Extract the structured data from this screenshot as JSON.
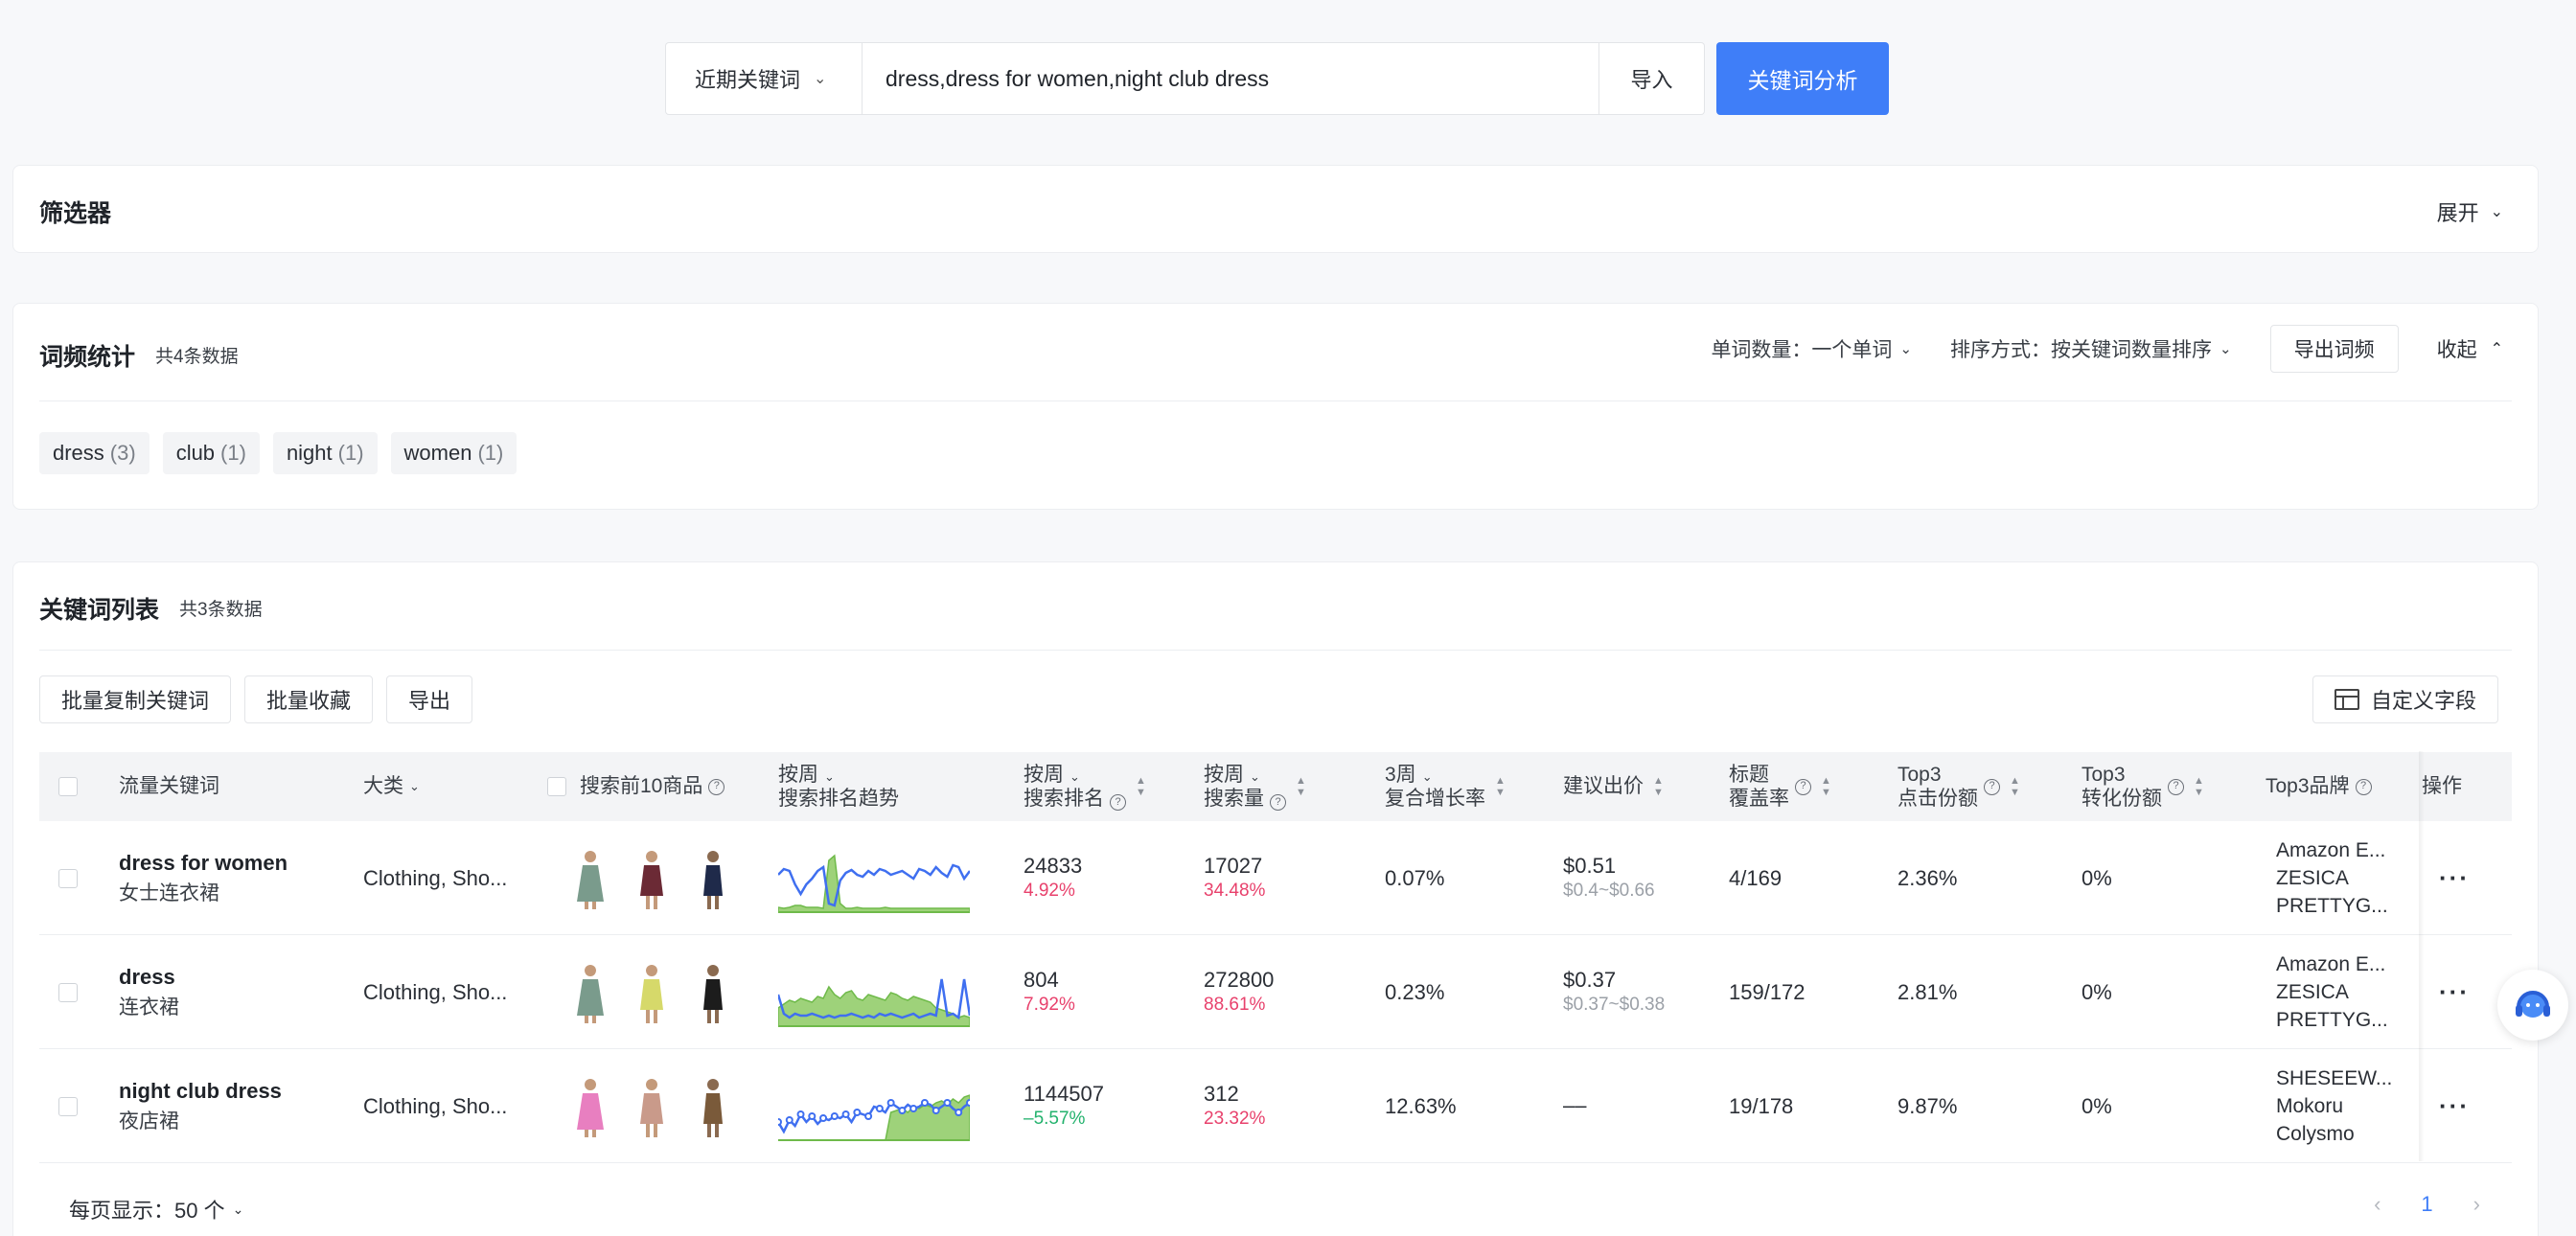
{
  "search": {
    "recent_label": "近期关键词",
    "input_value": "dress,dress for women,night club dress",
    "import_label": "导入",
    "analyze_label": "关键词分析"
  },
  "filter": {
    "title": "筛选器",
    "expand_label": "展开"
  },
  "word_freq": {
    "title": "词频统计",
    "count": "共4条数据",
    "word_count_label": "单词数量：一个单词",
    "sort_label": "排序方式：按关键词数量排序",
    "export_label": "导出词频",
    "collapse_label": "收起",
    "tags": [
      {
        "word": "dress",
        "n": "(3)"
      },
      {
        "word": "club",
        "n": "(1)"
      },
      {
        "word": "night",
        "n": "(1)"
      },
      {
        "word": "women",
        "n": "(1)"
      }
    ]
  },
  "keyword_list": {
    "title": "关键词列表",
    "count": "共3条数据",
    "batch_copy": "批量复制关键词",
    "batch_fav": "批量收藏",
    "export": "导出",
    "custom_fields": "自定义字段",
    "columns": {
      "keyword": "流量关键词",
      "category": "大类",
      "top10": "搜索前10商品",
      "trend_a": "按周",
      "trend_b": "搜索排名趋势",
      "rank_a": "按周",
      "rank_b": "搜索排名",
      "volume_a": "按周",
      "volume_b": "搜索量",
      "growth_a": "3周",
      "growth_b": "复合增长率",
      "bid": "建议出价",
      "title_a": "标题",
      "title_b": "覆盖率",
      "click_a": "Top3",
      "click_b": "点击份额",
      "conv_a": "Top3",
      "conv_b": "转化份额",
      "brand": "Top3品牌",
      "ops": "操作"
    },
    "rows": [
      {
        "keyword": "dress for women",
        "keyword_cn": "女士连衣裙",
        "category": "Clothing, Sho...",
        "rank": "24833",
        "rank_change": "4.92%",
        "volume": "17027",
        "volume_change": "34.48%",
        "growth": "0.07%",
        "bid": "$0.51",
        "bid_range": "$0.4~$0.66",
        "title_cov": "4/169",
        "click_share": "2.36%",
        "conv_share": "0%",
        "brands": [
          "Amazon E...",
          "ZESICA",
          "PRETTYG..."
        ],
        "thumb_colors": [
          "#7a9b8c",
          "#6b2a35",
          "#1f2a4a"
        ],
        "rank_trend": [
          40,
          46,
          44,
          30,
          20,
          30,
          36,
          44,
          48,
          10,
          8,
          34,
          42,
          45,
          40,
          38,
          44,
          40,
          46,
          44,
          40,
          42,
          44,
          40,
          36,
          46,
          44,
          40,
          48,
          42,
          38,
          50,
          48,
          36,
          44
        ],
        "volume_trend": [
          6,
          5,
          6,
          8,
          8,
          6,
          6,
          6,
          5,
          55,
          60,
          10,
          5,
          5,
          6,
          5,
          5,
          5,
          5,
          6,
          5,
          5,
          5,
          5,
          5,
          5,
          5,
          5,
          5,
          5,
          5,
          5,
          5,
          5,
          5
        ]
      },
      {
        "keyword": "dress",
        "keyword_cn": "连衣裙",
        "category": "Clothing, Sho...",
        "rank": "804",
        "rank_change": "7.92%",
        "volume": "272800",
        "volume_change": "88.61%",
        "growth": "0.23%",
        "bid": "$0.37",
        "bid_range": "$0.37~$0.38",
        "title_cov": "159/172",
        "click_share": "2.81%",
        "conv_share": "0%",
        "brands": [
          "Amazon E...",
          "ZESICA",
          "PRETTYG..."
        ],
        "thumb_colors": [
          "#7a9b8c",
          "#d6d96a",
          "#1c1c1c"
        ],
        "rank_trend": [
          34,
          14,
          10,
          14,
          12,
          12,
          14,
          12,
          10,
          12,
          10,
          12,
          12,
          14,
          12,
          10,
          12,
          10,
          14,
          12,
          14,
          12,
          10,
          12,
          14,
          10,
          12,
          14,
          12,
          50,
          12,
          14,
          10,
          50,
          12
        ],
        "volume_trend": [
          20,
          24,
          28,
          26,
          30,
          28,
          26,
          32,
          30,
          42,
          34,
          30,
          36,
          38,
          30,
          28,
          34,
          32,
          30,
          28,
          36,
          34,
          30,
          28,
          32,
          30,
          28,
          26,
          20,
          18,
          16,
          14,
          10,
          12,
          10
        ]
      },
      {
        "keyword": "night club dress",
        "keyword_cn": "夜店裙",
        "category": "Clothing, Sho...",
        "rank": "1144507",
        "rank_change": "–5.57%",
        "volume": "312",
        "volume_change": "23.32%",
        "growth": "12.63%",
        "bid": "––",
        "bid_range": "",
        "title_cov": "19/178",
        "click_share": "9.87%",
        "conv_share": "0%",
        "brands": [
          "SHESEEW...",
          "Mokoru",
          "Colysmo"
        ],
        "thumb_colors": [
          "#e87fc0",
          "#c99a8a",
          "#7a5a3a"
        ],
        "rank_trend": [
          20,
          10,
          22,
          16,
          28,
          20,
          26,
          18,
          24,
          22,
          26,
          24,
          28,
          20,
          30,
          28,
          26,
          36,
          34,
          30,
          40,
          36,
          32,
          38,
          34,
          36,
          40,
          38,
          32,
          36,
          40,
          34,
          30,
          36,
          40
        ],
        "volume_trend": [
          0,
          0,
          0,
          0,
          0,
          0,
          0,
          0,
          0,
          0,
          0,
          0,
          0,
          0,
          0,
          0,
          0,
          0,
          0,
          0,
          30,
          32,
          34,
          30,
          36,
          34,
          38,
          36,
          40,
          42,
          38,
          44,
          40,
          46,
          48
        ]
      }
    ]
  },
  "pagination": {
    "page_size_label": "每页显示：50 个",
    "current_page": "1"
  }
}
